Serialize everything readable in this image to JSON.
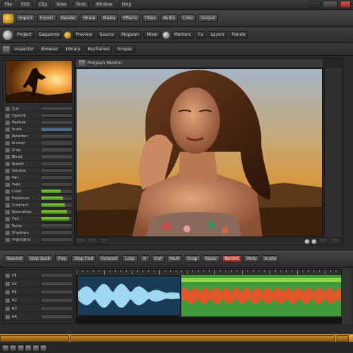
{
  "menu": {
    "items": [
      "File",
      "Edit",
      "Clip",
      "View",
      "Tools",
      "Window",
      "Help"
    ]
  },
  "toolbar1": {
    "buttons": [
      "Import",
      "Export",
      "Render",
      "Share",
      "Media",
      "Effects",
      "Titles",
      "Audio",
      "Color",
      "Output"
    ]
  },
  "toolbar2": {
    "buttons": [
      "Project",
      "Sequence",
      "Preview",
      "Source",
      "Program",
      "Mixer",
      "Markers",
      "Fx",
      "Layers",
      "Panels"
    ]
  },
  "toolbar3": {
    "buttons": [
      "Inspector",
      "Browser",
      "Library",
      "Keyframes",
      "Scopes"
    ]
  },
  "viewer": {
    "header": "Program Monitor"
  },
  "inspector": {
    "rows": [
      "Clip",
      "Opacity",
      "Position",
      "Scale",
      "Rotation",
      "Anchor",
      "Crop",
      "Blend",
      "Speed",
      "Volume",
      "Pan",
      "Fade",
      "Color",
      "Exposure",
      "Contrast",
      "Saturation",
      "Tint",
      "Temp",
      "Shadows",
      "Highlights"
    ],
    "selected_row": 3
  },
  "transport": {
    "buttons": [
      "Rewind",
      "Step Back",
      "Play",
      "Step Fwd",
      "Forward",
      "Loop",
      "In",
      "Out",
      "Mark",
      "Snap",
      "Razor",
      "Record",
      "Mute",
      "Audio"
    ]
  },
  "tracks": {
    "rows": [
      "V1",
      "V2",
      "A1",
      "A2",
      "A3",
      "A4"
    ]
  },
  "colors": {
    "accent": "#e8a33a",
    "record": "#c8483a",
    "selection": "#4f6b8a",
    "level": "#7bc63a"
  },
  "icons": [
    "camera-icon",
    "film-reel-icon",
    "gear-icon",
    "play-icon",
    "record-icon",
    "speaker-icon"
  ]
}
